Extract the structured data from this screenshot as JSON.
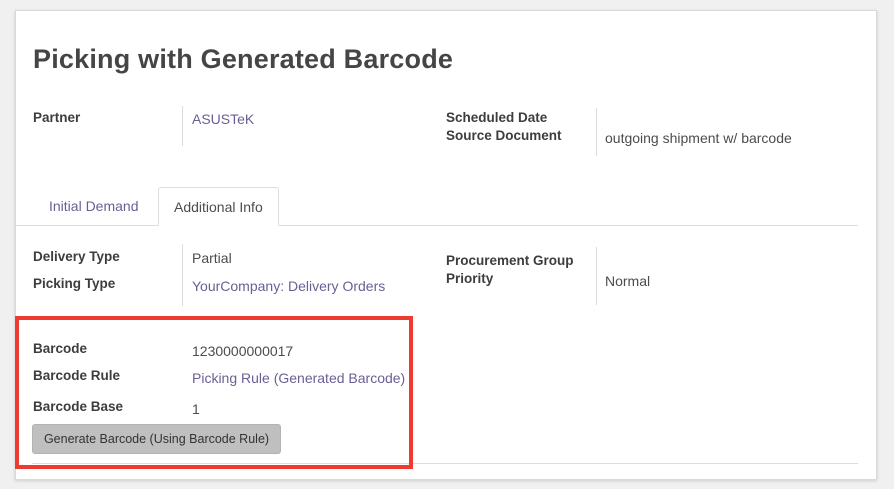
{
  "form": {
    "title": "Picking with Generated Barcode"
  },
  "header_fields": {
    "partner_label": "Partner",
    "partner_value": "ASUSTeK",
    "scheduled_date_label": "Scheduled Date",
    "source_document_label": "Source Document",
    "source_document_value": "outgoing shipment w/ barcode"
  },
  "tabs": [
    {
      "label": "Initial Demand",
      "active": false
    },
    {
      "label": "Additional Info",
      "active": true
    }
  ],
  "additional_info": {
    "delivery_type_label": "Delivery Type",
    "delivery_type_value": "Partial",
    "picking_type_label": "Picking Type",
    "picking_type_value": "YourCompany: Delivery Orders",
    "procurement_group_label": "Procurement Group",
    "priority_label": "Priority",
    "priority_value": "Normal"
  },
  "barcode": {
    "barcode_label": "Barcode",
    "barcode_value": "1230000000017",
    "rule_label": "Barcode Rule",
    "rule_value": "Picking Rule (Generated Barcode)",
    "base_label": "Barcode Base",
    "base_value": "1",
    "generate_button_label": "Generate Barcode (Using Barcode Rule)"
  },
  "colors": {
    "link": "#6c5e95",
    "highlight": "#ee3b2f",
    "button_bg": "#bfbfbf"
  }
}
